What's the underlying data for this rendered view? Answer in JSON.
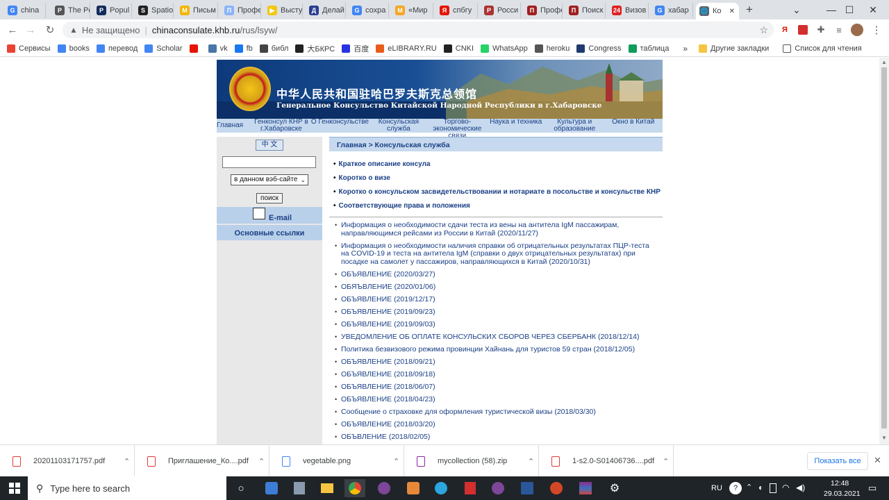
{
  "browser": {
    "tabs": [
      {
        "title": "china",
        "fav": "G",
        "color": "#4285f4"
      },
      {
        "title": "The Po",
        "fav": "P",
        "color": "#555"
      },
      {
        "title": "Popul",
        "fav": "P",
        "color": "#122c5a"
      },
      {
        "title": "Spatio",
        "fav": "S",
        "color": "#222"
      },
      {
        "title": "Письм",
        "fav": "M",
        "color": "#f4b400"
      },
      {
        "title": "Профе",
        "fav": "П",
        "color": "#8ab4f8"
      },
      {
        "title": "Высту",
        "fav": "▶",
        "color": "#f2c811"
      },
      {
        "title": "Делай",
        "fav": "Д",
        "color": "#2a3f8f"
      },
      {
        "title": "сохра",
        "fav": "G",
        "color": "#4285f4"
      },
      {
        "title": "«Мир",
        "fav": "М",
        "color": "#f5a623"
      },
      {
        "title": "спбгу",
        "fav": "Я",
        "color": "#e61400"
      },
      {
        "title": "Росси",
        "fav": "Р",
        "color": "#a33"
      },
      {
        "title": "Профе",
        "fav": "П",
        "color": "#a02020"
      },
      {
        "title": "Поиск",
        "fav": "П",
        "color": "#a02020"
      },
      {
        "title": "Визов",
        "fav": "24",
        "color": "#e02020"
      },
      {
        "title": "хабар",
        "fav": "G",
        "color": "#4285f4"
      },
      {
        "title": "Ко",
        "fav": "🌐",
        "color": "#5f6368"
      }
    ],
    "new_tab": "+",
    "address": {
      "security": "Не защищено",
      "host": "chinaconsulate.khb.ru",
      "path": "/rus/lsyw/"
    },
    "bookmarks": [
      {
        "label": "Сервисы",
        "color": "#ea4335"
      },
      {
        "label": "books",
        "color": "#4285f4"
      },
      {
        "label": "перевод",
        "color": "#4285f4"
      },
      {
        "label": "Scholar",
        "color": "#4285f4"
      },
      {
        "label": "",
        "color": "#e61400"
      },
      {
        "label": "vk",
        "color": "#4a76a8"
      },
      {
        "label": "fb",
        "color": "#1877f2"
      },
      {
        "label": "библ",
        "color": "#444"
      },
      {
        "label": "大БКРС",
        "color": "#222"
      },
      {
        "label": "百度",
        "color": "#2932e1"
      },
      {
        "label": "eLIBRARY.RU",
        "color": "#e85d1a"
      },
      {
        "label": "CNKI",
        "color": "#222"
      },
      {
        "label": "WhatsApp",
        "color": "#25d366"
      },
      {
        "label": "heroku",
        "color": "#555"
      },
      {
        "label": "Congress",
        "color": "#1e3a6e"
      },
      {
        "label": "таблица",
        "color": "#0f9d58"
      }
    ],
    "bookmarks_more": "»",
    "other_bookmarks": "Другие закладки",
    "reading_list": "Список для чтения"
  },
  "site": {
    "banner_cn": "中华人民共和国驻哈巴罗夫斯克总领馆",
    "banner_ru": "Генеральное Консульство Китайской Народной Республики в г.Хабаровске",
    "nav": [
      "Главная",
      "Генконсул КНР в г.Хабаровске",
      "О Генконсульстве",
      "Консульская служба",
      "Торгово-экономические связи",
      "Наука и техника",
      "Культура и образование",
      "Окно в Китай"
    ],
    "lang_button": "中 文",
    "search_scope": "в данном вэб-сайте",
    "search_button": "поиск",
    "email": "E-mail",
    "links": "Основные ссылки",
    "breadcrumb": "Главная > Консульская служба",
    "sections": [
      "Краткое описание консула",
      "Коротко о визе",
      "Коротко о консульском засвидетельствовании и нотариате в посольстве и консульстве КНР",
      "Соответствующие права и положения"
    ],
    "news": [
      "Информация о необходимости сдачи теста из вены на антитела IgM пассажирам, направляющимся рейсами из России в Китай (2020/11/27)",
      "Информация о необходимости наличия справки об отрицательных результатах ПЦР-теста на COVID-19 и теста на антитела IgM (справки о двух отрицательных результатах) при посадке на самолет у пассажиров, направляющихся в Китай (2020/10/31)",
      "ОБЪЯВЛЕНИЕ (2020/03/27)",
      "ОБЯЪВЛЕНИЕ (2020/01/06)",
      "ОБЪЯВЛЕНИЕ (2019/12/17)",
      "ОБЪЯВЛЕНИЕ (2019/09/23)",
      "ОБЪЯВЛЕНИЕ (2019/09/03)",
      "УВЕДОМЛЕНИЕ ОБ ОПЛАТЕ КОНСУЛЬСКИХ СБОРОВ ЧЕРЕЗ СБЕРБАНК (2018/12/14)",
      "Политика безвизового режима провинции Хайнань для туристов 59 стран (2018/12/05)",
      "ОБЪЯВЛЕНИЕ (2018/09/21)",
      "ОБЪЯВЛЕНИЕ (2018/09/18)",
      "ОБЪЯВЛЕНИЕ (2018/06/07)",
      "ОБЪЯВЛЕНИЕ (2018/04/23)",
      "Сообщение о страховке для оформления туристической визы (2018/03/30)",
      "ОБЪЯВЛЕНИЕ (2018/03/20)",
      "ОБЪВЛЕНИЕ (2018/02/05)"
    ]
  },
  "downloads": {
    "items": [
      {
        "name": "20201103171757.pdf",
        "icon": "pdf-icon",
        "color": "#e53935"
      },
      {
        "name": "Приглашение_Ко....pdf",
        "icon": "pdf-icon",
        "color": "#e53935"
      },
      {
        "name": "vegetable.png",
        "icon": "image-icon",
        "color": "#4285f4"
      },
      {
        "name": "mycollection (58).zip",
        "icon": "zip-icon",
        "color": "#8e24aa"
      },
      {
        "name": "1-s2.0-S01406736....pdf",
        "icon": "pdf-icon",
        "color": "#e53935"
      }
    ],
    "show_all": "Показать все"
  },
  "taskbar": {
    "search_placeholder": "Type here to search",
    "lang": "RU",
    "time": "12:48",
    "date": "29.03.2021"
  }
}
